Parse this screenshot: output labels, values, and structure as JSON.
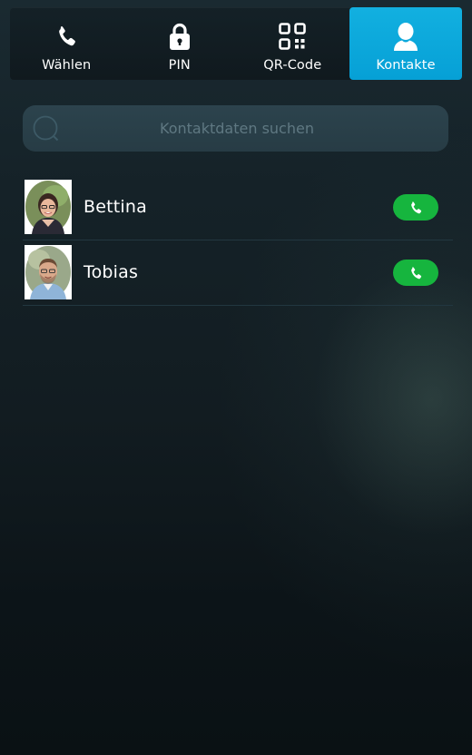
{
  "tabs": [
    {
      "label": "Wählen",
      "icon": "phone-icon",
      "active": false
    },
    {
      "label": "PIN",
      "icon": "lock-icon",
      "active": false
    },
    {
      "label": "QR-Code",
      "icon": "qr-code-icon",
      "active": false
    },
    {
      "label": "Kontakte",
      "icon": "person-icon",
      "active": true
    }
  ],
  "search": {
    "placeholder": "Kontaktdaten suchen",
    "value": ""
  },
  "contacts": [
    {
      "name": "Bettina",
      "avatar": "avatar-photo",
      "action_icon": "phone-icon"
    },
    {
      "name": "Tobias",
      "avatar": "avatar-photo",
      "action_icon": "phone-icon"
    }
  ],
  "colors": {
    "accent": "#06a0d6",
    "call_green": "#16b53e"
  }
}
